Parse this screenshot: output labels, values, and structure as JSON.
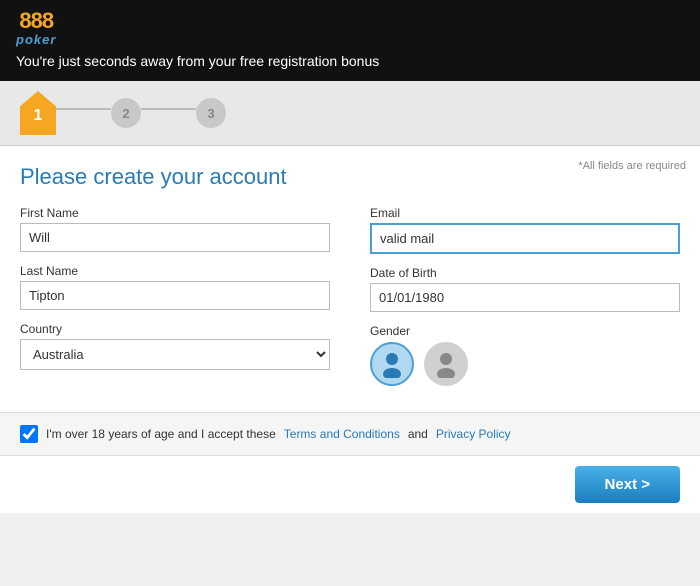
{
  "header": {
    "logo_888": "888",
    "logo_poker": "poker",
    "tagline": "You're just seconds away from your free registration bonus"
  },
  "steps": {
    "step1_label": "1",
    "step2_label": "2",
    "step3_label": "3"
  },
  "form": {
    "required_note": "*All fields are required",
    "title": "Please create your account",
    "first_name_label": "First Name",
    "first_name_value": "Will",
    "last_name_label": "Last Name",
    "last_name_value": "Tipton",
    "country_label": "Country",
    "country_value": "Australia",
    "email_label": "Email",
    "email_value": "valid mail",
    "dob_label": "Date of Birth",
    "dob_value": "01/01/1980",
    "gender_label": "Gender",
    "gender_male": "Male",
    "gender_female": "Female"
  },
  "terms": {
    "text_before": "I'm over 18 years of age and I accept these",
    "terms_link": "Terms and Conditions",
    "text_middle": "and",
    "privacy_link": "Privacy Policy"
  },
  "footer": {
    "next_button": "Next >"
  }
}
